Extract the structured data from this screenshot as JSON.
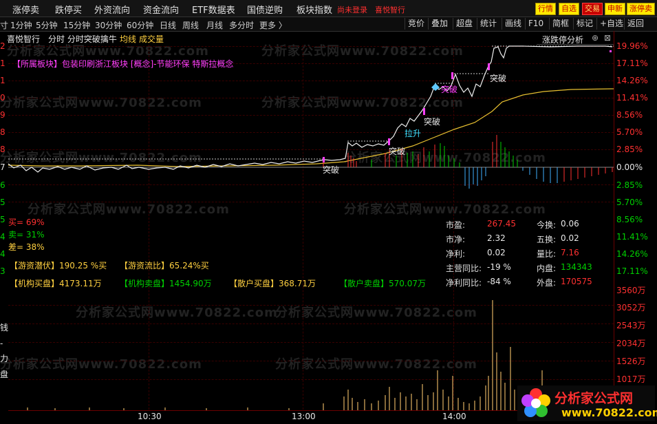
{
  "menu": {
    "items": [
      "涨停卖",
      "跌停买",
      "外资流向",
      "资金流向",
      "ETF数据表",
      "国债逆购",
      "板块指数"
    ],
    "login": "尚未登录",
    "brand": "喜悦智行",
    "buttons": [
      "行情",
      "自选",
      "交易",
      "申新",
      "涨停卖"
    ]
  },
  "toolbar": {
    "left_label": "寸",
    "timeframes": [
      "1分钟",
      "5分钟",
      "15分钟",
      "30分钟",
      "60分钟",
      "日线",
      "周线",
      "月线",
      "多分时",
      "更多 〉"
    ],
    "right_buttons": [
      "竞价",
      "叠加",
      "超盘",
      "统计",
      "画线",
      "F10",
      "简框",
      "标记",
      "+自选",
      "返回"
    ]
  },
  "chart": {
    "brand": "喜悦智行",
    "title": "分时  分时突破擒牛",
    "legend_avg": "均线",
    "legend_vol": "成交量",
    "panel_title": "涨跌停分析",
    "sector_line": "【所属板块】包装印刷浙江板块 [概念]-节能环保 特斯拉概念",
    "right_axis_up": [
      "19.96%",
      "17.11%",
      "14.26%",
      "11.41%",
      "8.56%",
      "5.70%",
      "2.85%",
      "0.00%"
    ],
    "right_axis_down": [
      "2.85%",
      "5.70%",
      "8.56%",
      "11.41%",
      "14.26%",
      "17.11%"
    ],
    "left_axis_up": [
      "2",
      "1",
      "1",
      "0",
      "9",
      "8",
      "8",
      "7"
    ],
    "left_axis_down": [
      "6",
      "5",
      "5",
      "4",
      "4",
      "3"
    ],
    "vol_axis": [
      "3560万",
      "3052万",
      "2543万",
      "2034万",
      "1526万",
      "1017万"
    ],
    "vol_left_glyphs": [
      "钱",
      "-",
      "力",
      "盘"
    ],
    "time_labels": [
      "10:30",
      "13:00",
      "14:00"
    ],
    "signals": [
      "突破",
      "突破",
      "拉升",
      "突破",
      "突破",
      "突破"
    ],
    "buy_ratio": "买= 69%",
    "sell_ratio": "卖= 31%",
    "diff_ratio": "差= 38%",
    "hot_money_latent": "【游资潜伏】190.25 %买",
    "hot_money_ratio": "【游资流比】65.24%买",
    "inst_buy": "【机构买盘】4173.11万",
    "inst_sell": "【机构卖盘】1454.90万",
    "retail_buy": "【散户买盘】368.71万",
    "retail_sell": "【散户卖盘】570.07万"
  },
  "stats": {
    "pe_label": "市盈:",
    "pe": "267.45",
    "turnover_label": "今换:",
    "turnover": "0.06",
    "pb_label": "市净:",
    "pb": "2.32",
    "turnover5_label": "五换:",
    "turnover5": "0.02",
    "profit_label": "净利:",
    "profit": "0.02",
    "volratio_label": "量比:",
    "volratio": "7.16",
    "rev_yoy_label": "主营同比:",
    "rev_yoy": "-19 %",
    "inner_label": "内盘:",
    "inner": "134343",
    "profit_yoy_label": "净利同比:",
    "profit_yoy": "-84 %",
    "outer_label": "外盘:",
    "outer": "170575"
  },
  "watermark": "分析家公式网www.70822.com",
  "logo": {
    "name": "分析家公式网",
    "url": "www.70822.com"
  }
}
